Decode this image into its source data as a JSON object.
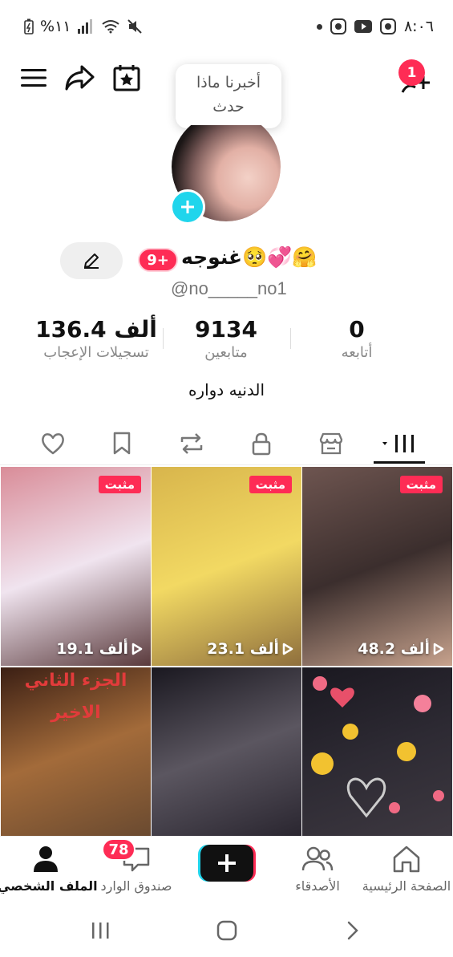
{
  "status_bar": {
    "battery": "%١١",
    "time": "٨:٠٦"
  },
  "header": {
    "notification_count": "1",
    "tooltip_line1": "أخبرنا ماذا",
    "tooltip_line2": "حدث"
  },
  "profile": {
    "display_name": "غنوجه🥺💞🤗",
    "badge": "9+",
    "username": "@no_____no1",
    "bio": "الدنيه دواره"
  },
  "stats": {
    "following": {
      "value": "0",
      "label": "أتابعه"
    },
    "followers": {
      "value": "9134",
      "label": "متابعين"
    },
    "likes": {
      "value": "136.4 ألف",
      "label": "تسجيلات الإعجاب"
    }
  },
  "tabs": [
    "videos",
    "shop",
    "private",
    "reposts",
    "favorites",
    "liked"
  ],
  "videos": [
    {
      "pinned": "مثبت",
      "views": "19.1 ألف",
      "colors": [
        "#d98c98",
        "#f0e4ef",
        "#5a3a3c"
      ]
    },
    {
      "pinned": "مثبت",
      "views": "23.1 ألف",
      "colors": [
        "#d8b54c",
        "#f2d963",
        "#8f6f3d"
      ]
    },
    {
      "pinned": "مثبت",
      "views": "48.2 ألف",
      "colors": [
        "#6e5550",
        "#3b2e2d",
        "#c7a28d"
      ]
    },
    {
      "title1": "الجزء الثاني",
      "title2": "الاخير",
      "colors": [
        "#3b1f14",
        "#a36b3a",
        "#6a4a30"
      ]
    },
    {
      "colors": [
        "#1a1820",
        "#5b5660",
        "#2a2630"
      ]
    },
    {
      "colors": [
        "#1a1820",
        "#2d2a33",
        "#3d3840"
      ]
    }
  ],
  "bottom_nav": {
    "home": "الصفحة الرئيسية",
    "friends": "الأصدقاء",
    "inbox": "صندوق الوارد",
    "inbox_badge": "78",
    "profile": "الملف الشخصي"
  },
  "colors": {
    "accent": "#fe2c55",
    "cyan": "#20d5ec"
  }
}
